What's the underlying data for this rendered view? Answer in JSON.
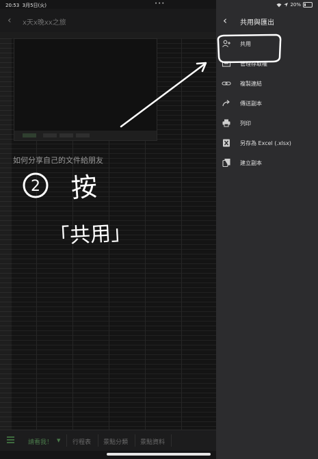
{
  "status_bar": {
    "time": "20:53",
    "date": "3月5日(火)",
    "dots": "•••",
    "battery": "20%"
  },
  "app": {
    "title": "x天x晚xx之旅",
    "caption": "如何分享自己的文件給朋友",
    "bottom_tabs": [
      {
        "label": "請看我！"
      },
      {
        "label": "行程表"
      },
      {
        "label": "景點分類"
      },
      {
        "label": "景點資料"
      }
    ]
  },
  "panel": {
    "title": "共用與匯出",
    "items": [
      {
        "label": "共用",
        "icon": "person-add-icon"
      },
      {
        "label": "管理存取權",
        "icon": "manage-access-icon"
      },
      {
        "label": "複製連結",
        "icon": "link-icon"
      },
      {
        "label": "傳送副本",
        "icon": "forward-icon"
      },
      {
        "label": "列印",
        "icon": "print-icon"
      },
      {
        "label": "另存為 Excel (.xlsx)",
        "icon": "excel-icon"
      },
      {
        "label": "建立副本",
        "icon": "copy-icon"
      }
    ]
  },
  "annotation": {
    "step_number": "2",
    "handwriting": "按",
    "quote": "「共用」"
  },
  "colors": {
    "accent_green": "#3e6b3e",
    "panel_bg": "#2c2c2e",
    "annotation": "#ffffff"
  }
}
